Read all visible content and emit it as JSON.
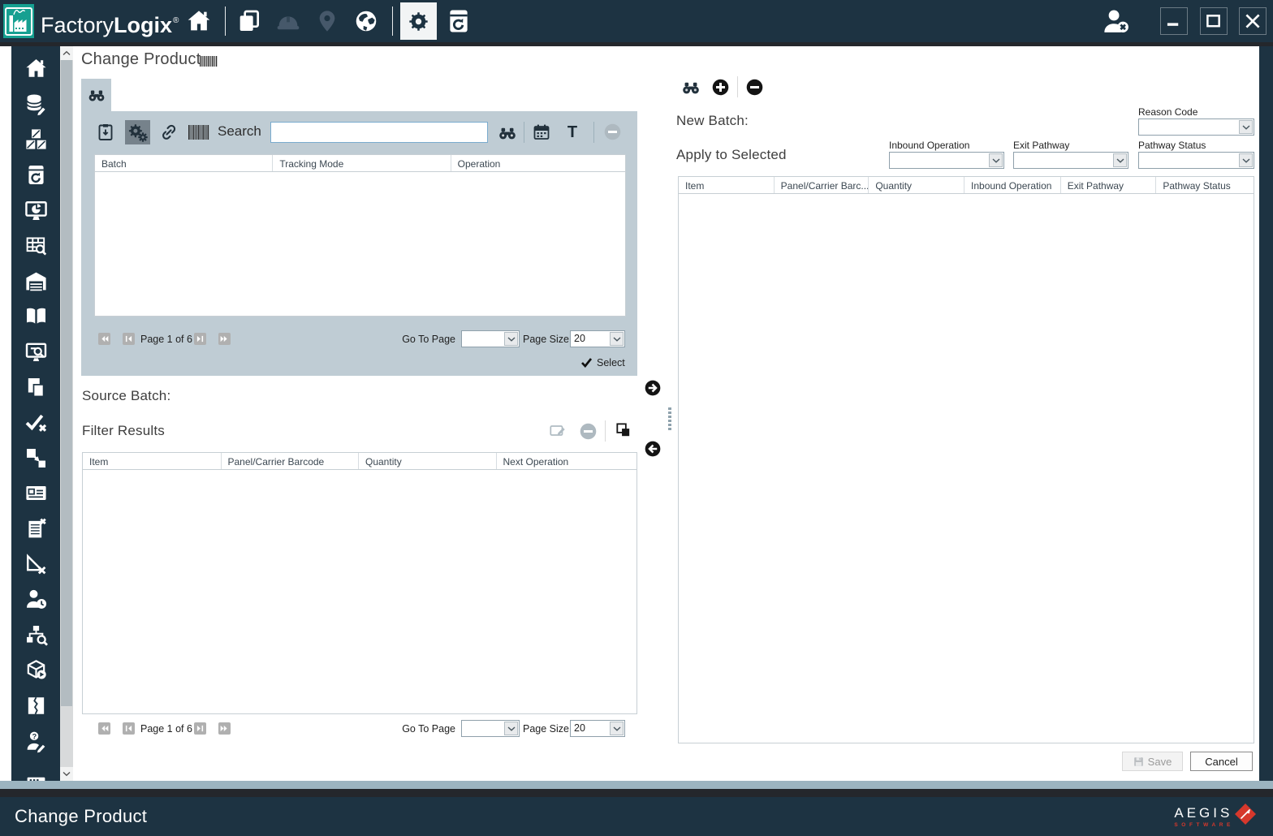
{
  "brand": {
    "factory": "Factory",
    "logix": "Logix",
    "mark": "®"
  },
  "page_title": "Change Product",
  "sidebar": {
    "icons": [
      "home",
      "database-edit",
      "pallets",
      "history-document",
      "dashboard-monitor",
      "table-search",
      "warehouse",
      "open-book",
      "monitor-search",
      "documents",
      "verify-check",
      "transfer-item",
      "id-card",
      "checklist-remove",
      "measure-remove",
      "person-time",
      "hierarchy-search",
      "box-forward",
      "torn-document",
      "person-question",
      "window-partial"
    ]
  },
  "left_panel": {
    "search_label": "Search",
    "search_value": "",
    "toolbar_t_label": "T",
    "batch_table": {
      "columns": [
        "Batch",
        "Tracking Mode",
        "Operation"
      ]
    },
    "pagination": {
      "page_status": "Page 1 of 6",
      "goto_label": "Go To Page",
      "goto_value": "",
      "size_label": "Page Size",
      "size_value": "20"
    },
    "select_label": "Select",
    "source_batch_label": "Source Batch:",
    "filter_results_label": "Filter Results",
    "filter_table": {
      "columns": [
        "Item",
        "Panel/Carrier Barcode",
        "Quantity",
        "Next Operation"
      ]
    },
    "pagination2": {
      "page_status": "Page 1 of 6",
      "goto_label": "Go To Page",
      "goto_value": "",
      "size_label": "Page Size",
      "size_value": "20"
    }
  },
  "right_panel": {
    "new_batch_label": "New Batch:",
    "apply_to_selected_label": "Apply to Selected",
    "reason_code_label": "Reason Code",
    "reason_code_value": "",
    "inbound_operation_label": "Inbound Operation",
    "inbound_operation_value": "",
    "exit_pathway_label": "Exit Pathway",
    "exit_pathway_value": "",
    "pathway_status_label": "Pathway Status",
    "pathway_status_value": "",
    "items_table": {
      "columns": [
        "Item",
        "Panel/Carrier Barc...",
        "Quantity",
        "Inbound Operation",
        "Exit Pathway",
        "Pathway Status"
      ]
    },
    "save_label": "Save",
    "cancel_label": "Cancel"
  },
  "footer": {
    "title": "Change Product",
    "logo_text": "AEGIS",
    "logo_subtext": "SOFTWARE"
  },
  "colors": {
    "topbar": "#1d3342",
    "teal": "#16a091",
    "panel": "#bfccd4",
    "logo_red": "#d6382c"
  }
}
